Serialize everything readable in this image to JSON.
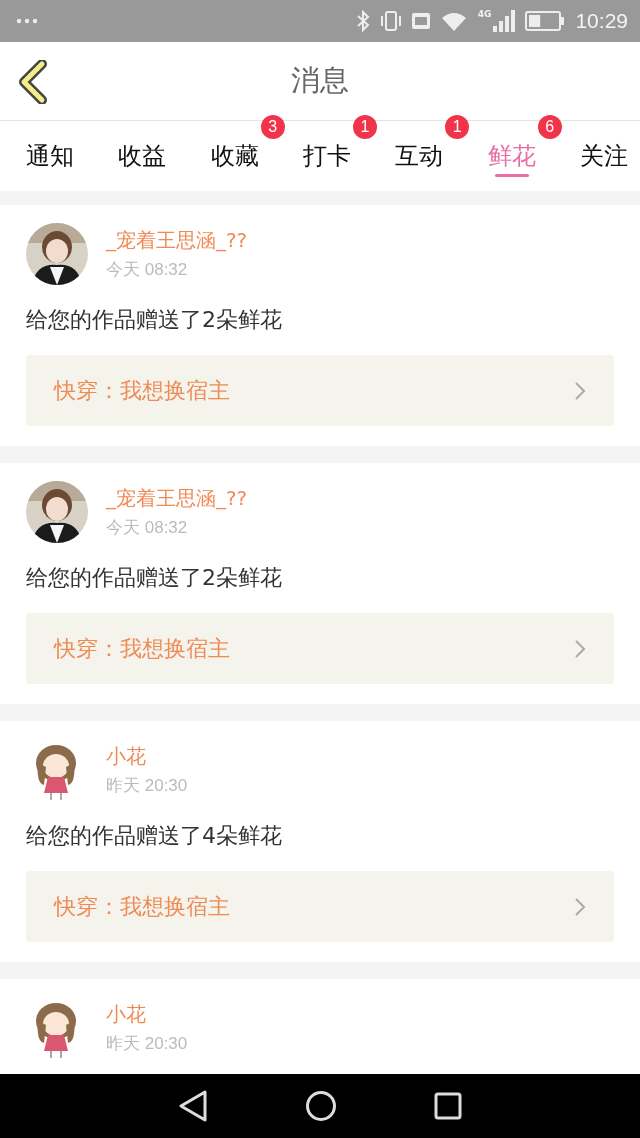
{
  "status_bar": {
    "time": "10:29",
    "network": "4G"
  },
  "header": {
    "title": "消息"
  },
  "tabs": [
    {
      "label": "通知",
      "selected": false
    },
    {
      "label": "收益",
      "selected": false
    },
    {
      "label": "收藏",
      "selected": false,
      "badge": "3"
    },
    {
      "label": "打卡",
      "selected": false,
      "badge": "1"
    },
    {
      "label": "互动",
      "selected": false,
      "badge": "1"
    },
    {
      "label": "鲜花",
      "selected": true,
      "badge": "6"
    },
    {
      "label": "关注",
      "selected": false
    }
  ],
  "messages": [
    {
      "name": "_宠着王思涵_??",
      "time": "今天 08:32",
      "text": "给您的作品赠送了2朵鲜花",
      "work": "快穿：我想换宿主"
    },
    {
      "name": "_宠着王思涵_??",
      "time": "今天 08:32",
      "text": "给您的作品赠送了2朵鲜花",
      "work": "快穿：我想换宿主"
    },
    {
      "name": "小花",
      "time": "昨天 20:30",
      "text": "给您的作品赠送了4朵鲜花",
      "work": "快穿：我想换宿主"
    },
    {
      "name": "小花",
      "time": "昨天 20:30"
    }
  ]
}
